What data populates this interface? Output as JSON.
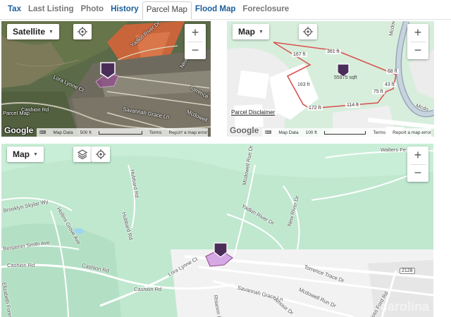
{
  "tabs": [
    {
      "label": "Tax",
      "state": "link"
    },
    {
      "label": "Last Listing",
      "state": "disabled"
    },
    {
      "label": "Photo",
      "state": "disabled"
    },
    {
      "label": "History",
      "state": "link"
    },
    {
      "label": "Parcel Map",
      "state": "active"
    },
    {
      "label": "Flood Map",
      "state": "link"
    },
    {
      "label": "Foreclosure",
      "state": "disabled"
    }
  ],
  "satellite_map": {
    "type_label": "Satellite",
    "streets": [
      "Yadkin River Dr",
      "New River Dr",
      "Lora Lynne Ct",
      "Cashion Rd",
      "Savannah Grace Ln",
      "Mcdowell",
      "Torrence",
      "Parcel Map"
    ],
    "footer": {
      "logo": "Google",
      "keyboard": "⌨",
      "map_data": "Map Data",
      "scale": "500 ft",
      "terms": "Terms",
      "report": "Report a map error"
    }
  },
  "parcel_map": {
    "type_label": "Map",
    "dimensions": [
      "361 ft",
      "167 ft",
      "163 ft",
      "172 ft",
      "114 ft",
      "68 ft",
      "43 ft",
      "75 ft"
    ],
    "area": "55975 sqft",
    "streets": [
      "Mcdowell Run Dr",
      "Mcdo"
    ],
    "disclaimer": "Parcel Disclaimer",
    "footer": {
      "logo": "Google",
      "keyboard": "⌨",
      "map_data": "Map Data",
      "scale": "100 ft",
      "terms": "Terms",
      "report": "Report a map error"
    }
  },
  "flood_map": {
    "type_label": "Map",
    "streets": [
      "Walters Fe",
      "Hubbard Rd",
      "Hubbard Rd",
      "Brooklyn Skylar Wy",
      "Hollins Grove Ave",
      "Benjamin Smith Ave",
      "Cashion Rd",
      "Cashion Rd",
      "Cashion Rd",
      "Mcdowell Run Dr",
      "Yadkin River Dr",
      "New River Dr",
      "Lora Lynne Ct",
      "Torrence Trace Dr",
      "Savannah Grace Ln",
      "Mcdowell Run Dr",
      "Rhianon Ln",
      "Amoux Dr",
      "Ross Ford Rd",
      "Elizabeth Forest Dr"
    ],
    "route_shield": "2128",
    "footer": {
      "watermark": "carolina"
    }
  },
  "colors": {
    "tab_link": "#1a5e9a",
    "parcel": "#8e4a8a",
    "parcel_outline": "#d9534f",
    "marker": "#4b2d5a",
    "flood_green": "#bfe8cf"
  },
  "icons": {
    "locate": "crosshair-icon",
    "layers": "layers-icon",
    "zoom_in": "plus-icon",
    "zoom_out": "minus-icon",
    "dropdown": "caret-down-icon",
    "marker": "home-marker-icon"
  }
}
